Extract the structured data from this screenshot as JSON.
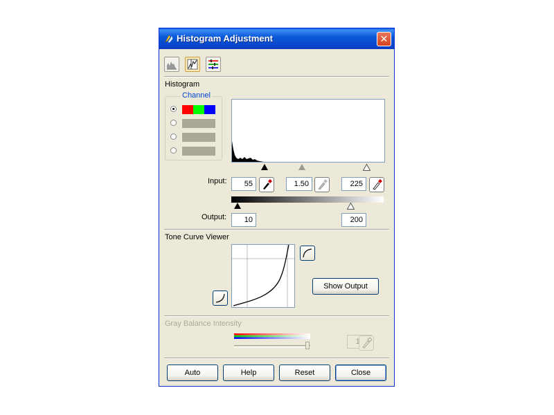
{
  "window": {
    "title": "Histogram Adjustment",
    "close_glyph": "✕"
  },
  "toolbar": {
    "icons": [
      "histogram-icon",
      "tone-curve-icon",
      "color-balance-icon"
    ],
    "active_index": 1
  },
  "histogram": {
    "section_label": "Histogram",
    "channel": {
      "group_title": "Channel",
      "selected_index": 0,
      "colors": [
        "#ff0000",
        "#00ff00",
        "#0000ff"
      ]
    },
    "input_label": "Input:",
    "input": {
      "shadow": "55",
      "gamma": "1.50",
      "highlight": "225"
    },
    "output_label": "Output:",
    "output": {
      "shadow": "10",
      "highlight": "200"
    }
  },
  "tone_curve": {
    "section_label": "Tone Curve Viewer",
    "show_output_label": "Show Output"
  },
  "gray_balance": {
    "section_label": "Gray Balance Intensity",
    "value": "100",
    "enabled": false
  },
  "buttons": {
    "auto": "Auto",
    "help": "Help",
    "reset": "Reset",
    "close": "Close"
  },
  "colors": {
    "title_bar": "#0a5fd8",
    "window_bg": "#ece9d8",
    "close_button": "#d3431e"
  }
}
